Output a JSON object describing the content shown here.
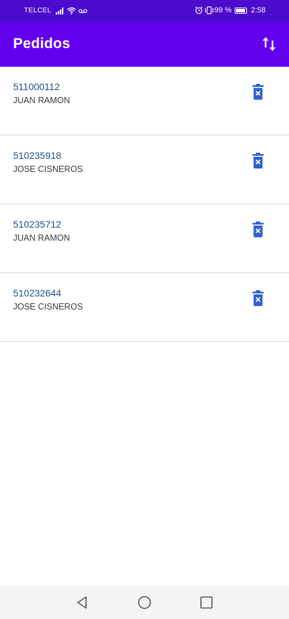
{
  "status_bar": {
    "carrier": "TELCEL",
    "battery_text": "99 %",
    "battery_level": 0.99,
    "time": "2:58",
    "icons": [
      "signal-icon",
      "wifi-icon",
      "voicemail-icon",
      "alarm-icon",
      "vibrate-icon",
      "battery-icon"
    ]
  },
  "app_bar": {
    "title": "Pedidos",
    "sort_icon": "swap-vert-icon"
  },
  "orders": [
    {
      "number": "511000112",
      "customer": "JUAN RAMON"
    },
    {
      "number": "510235918",
      "customer": "JOSE CISNEROS"
    },
    {
      "number": "510235712",
      "customer": "JUAN RAMON"
    },
    {
      "number": "510232644",
      "customer": "JOSE CISNEROS"
    }
  ],
  "nav_bar": {
    "icons": [
      "back-icon",
      "home-icon",
      "recents-icon"
    ]
  },
  "colors": {
    "status_bar": "#4a0bcc",
    "app_bar": "#6200ee",
    "order_number": "#1f4e8c",
    "delete_icon": "#2f5fd0"
  }
}
